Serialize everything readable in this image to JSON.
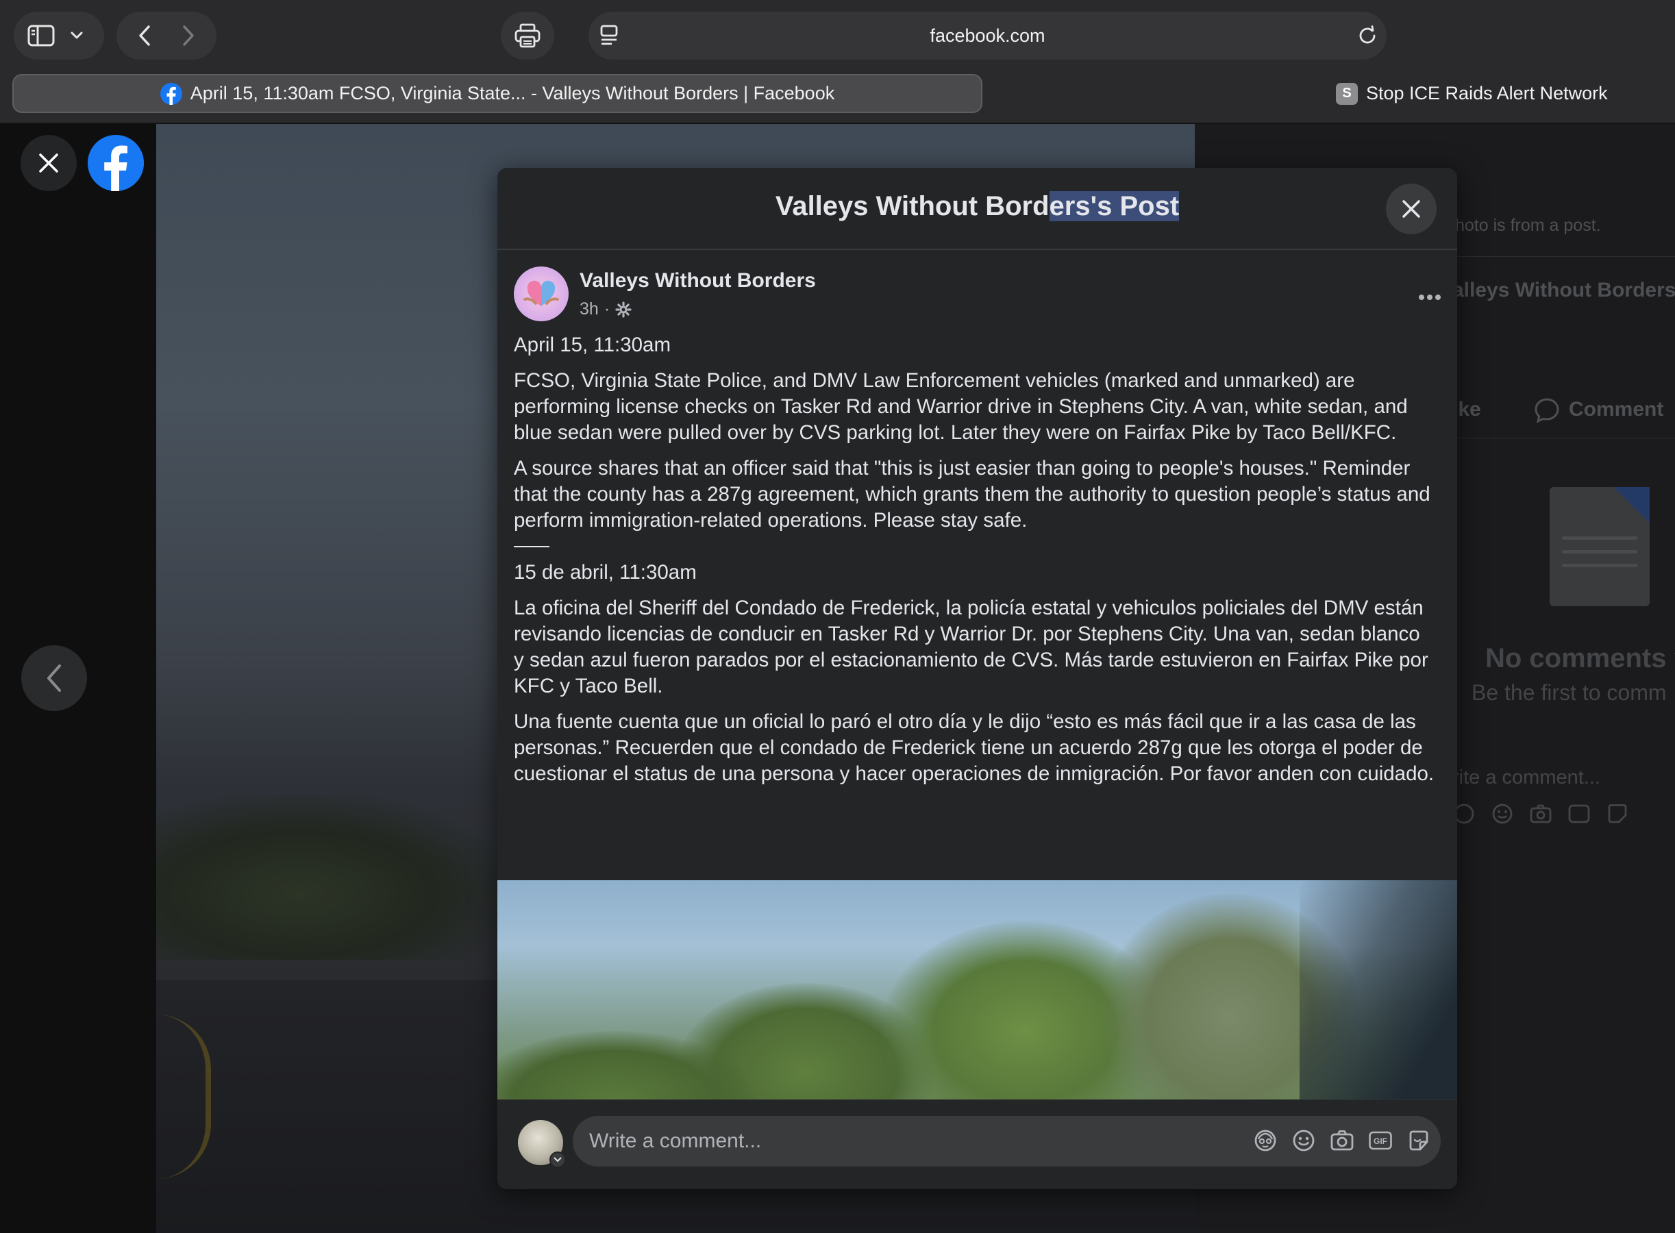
{
  "browser": {
    "url": "facebook.com",
    "tabs": [
      {
        "label": "April 15, 11:30am FCSO, Virginia State... - Valleys Without Borders | Facebook",
        "favicon": "facebook-icon",
        "active": true
      },
      {
        "label": "Stop ICE Raids Alert Network",
        "favicon": "S",
        "active": false
      }
    ]
  },
  "right_panel": {
    "photo_note": "hoto is from a post.",
    "author": "alleys Without Borders",
    "like": "ike",
    "comment": "Comment",
    "no_comments": "No comments y",
    "be_first": "Be the first to comm",
    "write_comment": "rite a comment..."
  },
  "modal": {
    "title_plain": "Valleys Without Bord",
    "title_highlight": "ers's Post",
    "post": {
      "author": "Valleys Without Borders",
      "time": "3h",
      "meta_separator": "·",
      "paragraphs_en": [
        "April 15, 11:30am",
        "FCSO, Virginia State Police, and DMV Law Enforcement vehicles (marked and unmarked) are performing license checks on Tasker Rd and Warrior drive in Stephens City. A van, white sedan, and blue sedan were pulled over by CVS parking lot. Later they were on Fairfax Pike by Taco Bell/KFC.",
        "A source shares that an officer said that \"this is just easier than going to people's houses.\" Reminder that the county has a 287g agreement, which grants them the authority to question people’s status and perform immigration-related operations. Please stay safe."
      ],
      "paragraphs_es": [
        "15 de abril, 11:30am",
        "La oficina del Sheriff del Condado de Frederick, la policía estatal y vehiculos policiales del DMV están revisando licencias de conducir en Tasker Rd y Warrior Dr. por Stephens City. Una van, sedan blanco y sedan azul fueron parados por el estacionamiento de CVS. Más tarde estuvieron en Fairfax Pike por KFC y Taco Bell.",
        "Una fuente cuenta que un oficial lo paró el otro día y le dijo “esto es más fácil que ir a las casa de las personas.” Recuerden que el condado de Frederick tiene un acuerdo 287g que les otorga el poder de cuestionar el status de una persona y hacer operaciones de inmigración. Por favor anden con cuidado."
      ]
    },
    "comment_box": {
      "placeholder": "Write a comment...",
      "icons": [
        "avatar-sticker-icon",
        "emoji-icon",
        "camera-icon",
        "gif-icon",
        "sticker-icon"
      ],
      "gif_label": "GIF"
    }
  },
  "colors": {
    "facebook_blue": "#1877f2",
    "modal_bg": "#242526",
    "input_bg": "#3a3b3c",
    "text_primary": "#e4e6eb",
    "text_secondary": "#b0b3b8",
    "title_highlight": "#3b4d78"
  }
}
